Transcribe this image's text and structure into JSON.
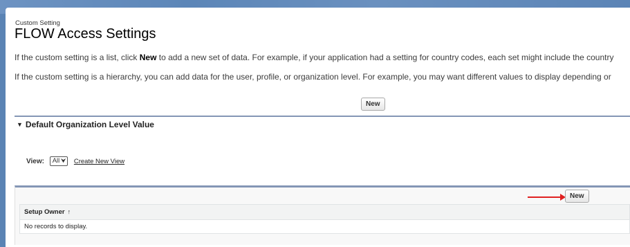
{
  "header": {
    "eyebrow": "Custom Setting",
    "title": "FLOW Access Settings"
  },
  "intro": {
    "list_prefix": "If the custom setting is a list, click ",
    "list_bold": "New",
    "list_suffix": " to add a new set of data. For example, if your application had a setting for country codes, each set might include the country",
    "hierarchy_text": "If the custom setting is a hierarchy, you can add data for the user, profile, or organization level. For example, you may want different values to display depending or"
  },
  "buttons": {
    "new_top": "New",
    "new_list": "New"
  },
  "section": {
    "toggle_glyph": "▼",
    "title": "Default Organization Level Value"
  },
  "view": {
    "label": "View:",
    "selected": "All",
    "create_link": "Create New View"
  },
  "table": {
    "columns": [
      "Setup Owner"
    ],
    "sort_glyph": "↑",
    "empty_message": "No records to display."
  },
  "colors": {
    "background": "#5a83b4",
    "divider": "#8496b5",
    "annotation_arrow": "#e02020"
  },
  "icons": {
    "dropdown": "chevron-down-icon",
    "sort": "sort-ascending-icon",
    "annotation": "red-arrow-icon"
  }
}
